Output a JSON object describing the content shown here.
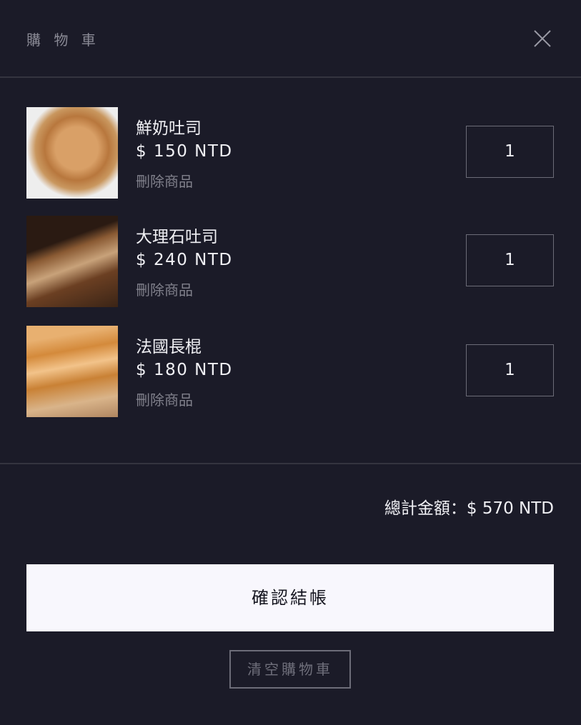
{
  "header": {
    "title": "購 物 車",
    "close_icon": "close-icon"
  },
  "items": [
    {
      "name": "鮮奶吐司",
      "price": "$ 150 NTD",
      "remove": "刪除商品",
      "quantity": "1"
    },
    {
      "name": "大理石吐司",
      "price": "$ 240 NTD",
      "remove": "刪除商品",
      "quantity": "1"
    },
    {
      "name": "法國長棍",
      "price": "$ 180 NTD",
      "remove": "刪除商品",
      "quantity": "1"
    }
  ],
  "summary": {
    "total": "總計金額：$ 570 NTD"
  },
  "actions": {
    "checkout": "確認結帳",
    "clear": "清空購物車"
  }
}
